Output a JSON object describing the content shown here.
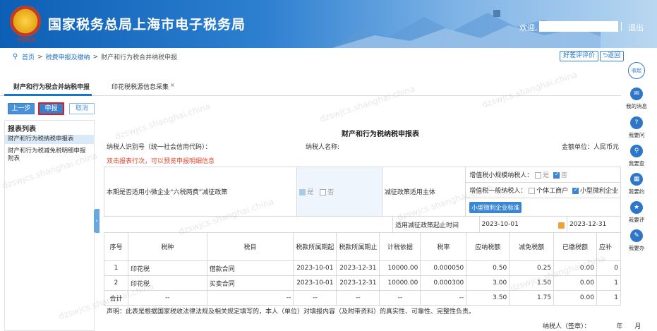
{
  "header": {
    "site_title": "国家税务总局上海市电子税务局",
    "emblem_caption": "中国税务",
    "welcome": "欢迎,",
    "logout": "退出"
  },
  "breadcrumb": {
    "home": "首页",
    "level1": "税费申报及缴纳",
    "current": "财产和行为税合并纳税申报"
  },
  "top_actions": {
    "review": "好差评评价",
    "back": "返回"
  },
  "tabs": [
    {
      "label": "财产和行为税合并纳税申报"
    },
    {
      "label": "印花税税源信息采集",
      "close": "×"
    }
  ],
  "toolbar": {
    "prev": "上一步",
    "submit": "申报",
    "cancel": "取消"
  },
  "report_list": {
    "title": "报表列表",
    "items": [
      "财产和行为税纳税申报表",
      "财产和行为税减免税明细申报",
      "附表"
    ]
  },
  "form": {
    "title": "财产和行为税纳税申报表",
    "taxpayer_id_label": "纳税人识别号（统一社会信用代码）：",
    "taxpayer_name_label": "纳税人名称:",
    "unit_label": "金额单位：人民币元（列至角分",
    "hint": "双击报表行次，可以预览申报明细信息",
    "policy_label": "本期是否适用小微企业“六税两费”减征政策",
    "yes": "是",
    "no": "否",
    "subject_label": "减征政策适用主体",
    "small_scale_label": "增值税小规模纳税人：",
    "general_label": "增值税一般纳税人：",
    "individual_label": "个体工商户",
    "micro_label": "小型微利企业",
    "micro_standard_btn": "小型微利企业标准",
    "period_label": "适用减征政策起止时间",
    "period_start": "2023-10-01",
    "period_end": "2023-12-31",
    "headers": [
      "序号",
      "税种",
      "税目",
      "税款所属期起",
      "税款所属期止",
      "计税依据",
      "税率",
      "应纳税额",
      "减免税额",
      "已缴税额",
      "应补"
    ],
    "rows": [
      [
        "1",
        "印花税",
        "借款合同",
        "2023-10-01",
        "2023-12-31",
        "10000.00",
        "0.000050",
        "0.50",
        "0.25",
        "0.00",
        "0"
      ],
      [
        "2",
        "印花税",
        "买卖合同",
        "2023-10-01",
        "2023-12-31",
        "10000.00",
        "0.000300",
        "3.00",
        "1.50",
        "0.00",
        "1"
      ]
    ],
    "total": [
      "合计",
      "--",
      "--",
      "--",
      "--",
      "--",
      "--",
      "3.50",
      "1.75",
      "0.00",
      "1"
    ],
    "declaration": "声明：此表是根据国家税收法律法规及相关规定填写的，本人（单位）对填报内容（及附带资料）的真实性、可靠性、完整性负责。",
    "sign_label": "纳税人（签章）：",
    "year_label": "年",
    "month_label": "月"
  },
  "float_bar": {
    "collapse": "收起",
    "items": [
      "我的消息",
      "我要问",
      "我要查",
      "我要约",
      "我要评",
      "我要办"
    ]
  },
  "watermark": "dzswjcs.shanghai.china"
}
